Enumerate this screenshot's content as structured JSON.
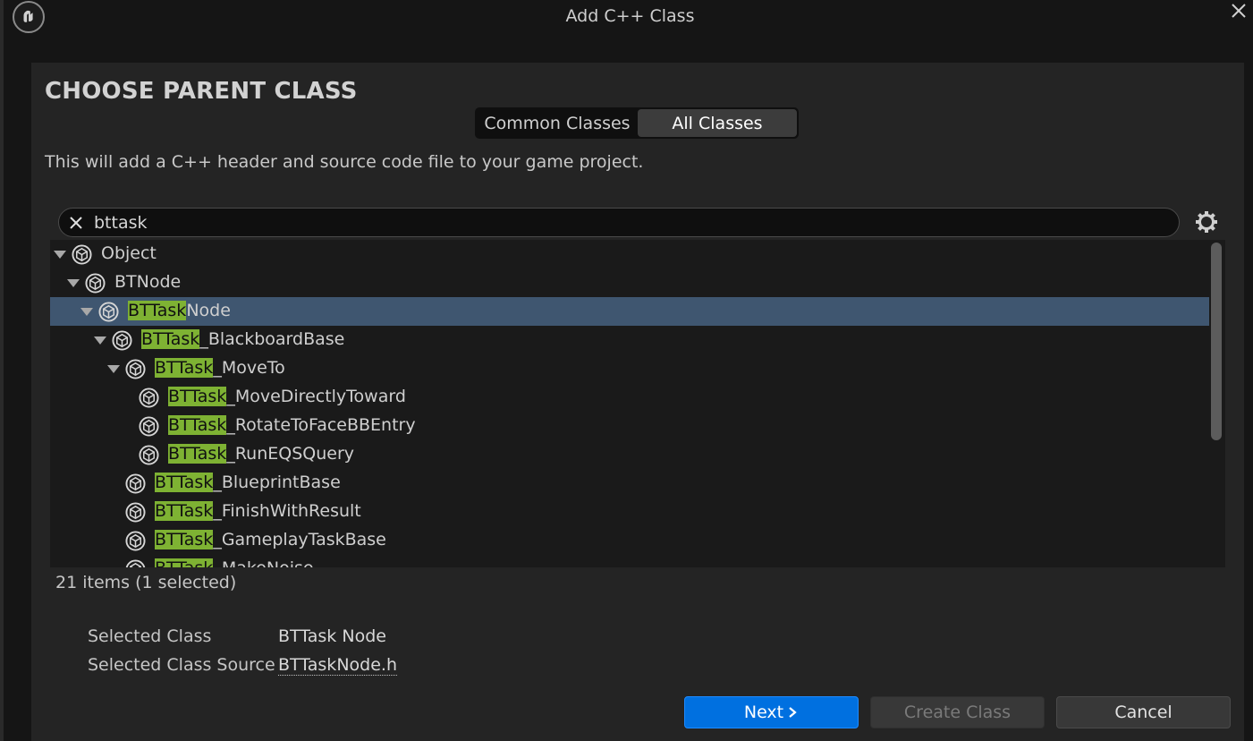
{
  "window": {
    "title": "Add C++ Class"
  },
  "heading": "CHOOSE PARENT CLASS",
  "tabs": [
    {
      "label": "Common Classes",
      "active": false
    },
    {
      "label": "All Classes",
      "active": true
    }
  ],
  "description": "This will add a C++ header and source code file to your game project.",
  "search": {
    "value": "bttask"
  },
  "tree": {
    "items": [
      {
        "match": "",
        "rest": "Object",
        "expanded": true,
        "selected": false
      },
      {
        "match": "",
        "rest": "BTNode",
        "expanded": true,
        "selected": false
      },
      {
        "match": "BTTask",
        "rest": "Node",
        "expanded": true,
        "selected": true
      },
      {
        "match": "BTTask",
        "rest": "_BlackboardBase",
        "expanded": true,
        "selected": false
      },
      {
        "match": "BTTask",
        "rest": "_MoveTo",
        "expanded": true,
        "selected": false
      },
      {
        "match": "BTTask",
        "rest": "_MoveDirectlyToward",
        "expanded": false,
        "selected": false
      },
      {
        "match": "BTTask",
        "rest": "_RotateToFaceBBEntry",
        "expanded": false,
        "selected": false
      },
      {
        "match": "BTTask",
        "rest": "_RunEQSQuery",
        "expanded": false,
        "selected": false
      },
      {
        "match": "BTTask",
        "rest": "_BlueprintBase",
        "expanded": false,
        "selected": false
      },
      {
        "match": "BTTask",
        "rest": "_FinishWithResult",
        "expanded": false,
        "selected": false
      },
      {
        "match": "BTTask",
        "rest": "_GameplayTaskBase",
        "expanded": false,
        "selected": false
      },
      {
        "match": "BTTask",
        "rest": "_MakeNoise",
        "expanded": false,
        "selected": false
      }
    ]
  },
  "status": {
    "count": "21 items (1 selected)"
  },
  "details": {
    "selected_class_label": "Selected Class",
    "selected_class_value": "BTTask Node",
    "selected_source_label": "Selected Class Source",
    "selected_source_value": "BTTaskNode.h"
  },
  "buttons": {
    "next": "Next",
    "create": "Create Class",
    "cancel": "Cancel"
  },
  "colors": {
    "accent": "#0070e0",
    "highlight": "#7eb233",
    "selection": "#3f5670"
  }
}
